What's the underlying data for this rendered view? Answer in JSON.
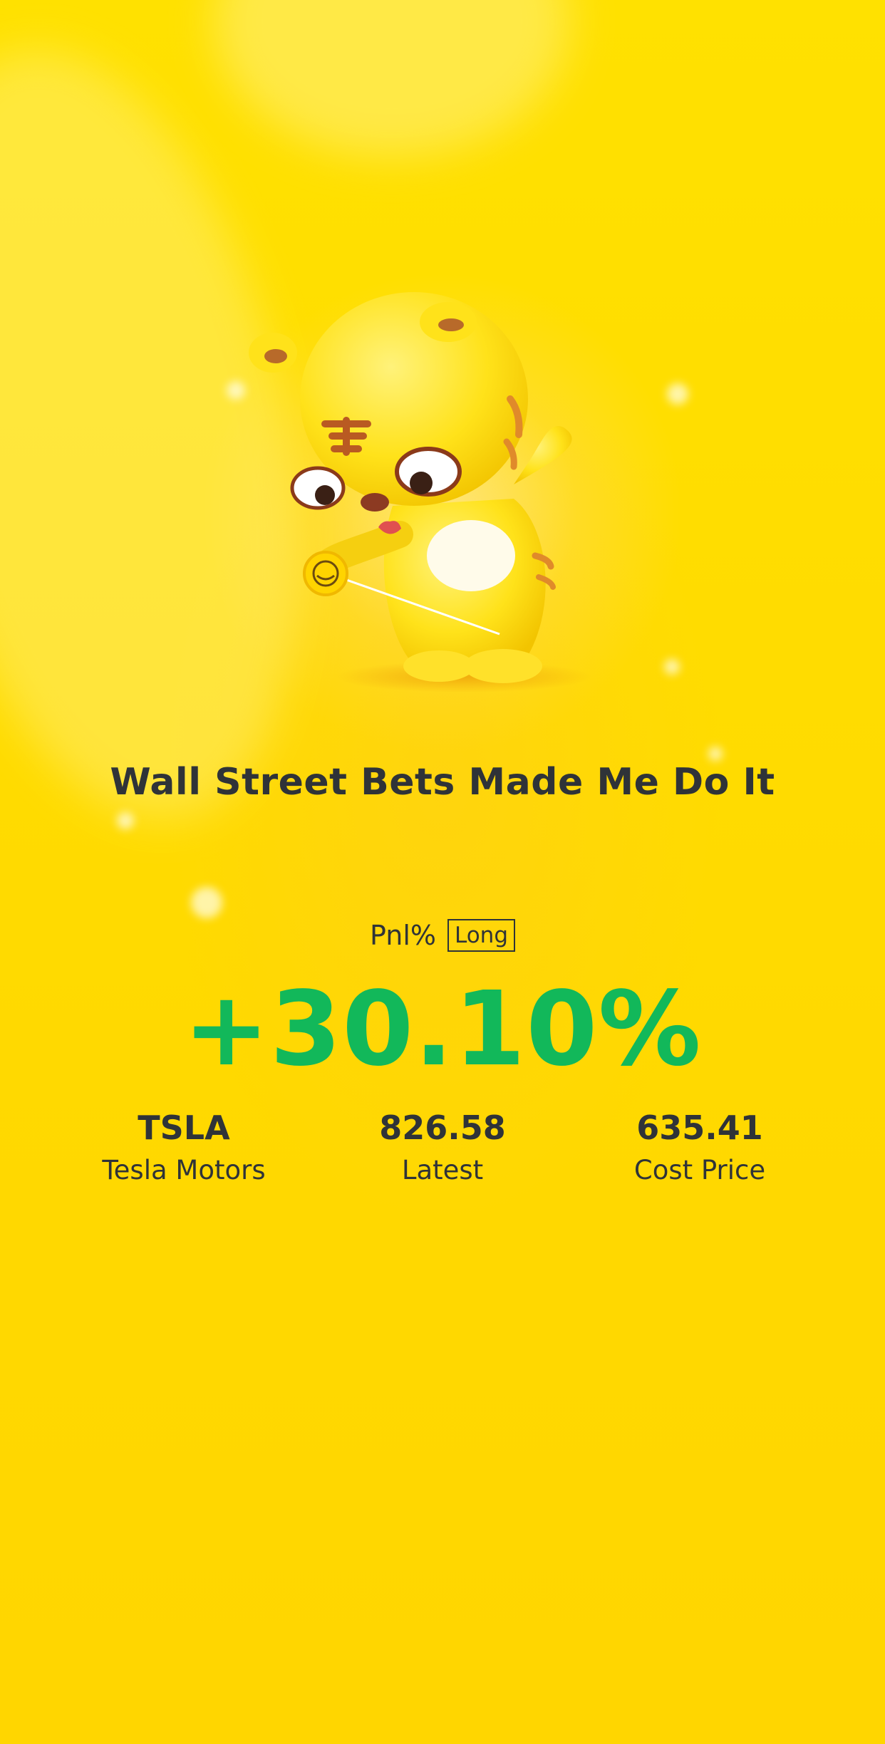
{
  "card": {
    "title": "Wall Street Bets Made Me Do It",
    "pnl_label": "Pnl%",
    "position_tag": "Long",
    "pnl_value": "+30.10%",
    "pnl_color": "#12b85a",
    "background_color": "#ffdd00"
  },
  "stats": [
    {
      "value": "TSLA",
      "label": "Tesla Motors"
    },
    {
      "value": "826.58",
      "label": "Latest"
    },
    {
      "value": "635.41",
      "label": "Cost Price"
    }
  ],
  "mascot": {
    "icon": "tiger-mascot-with-yoyo-icon"
  }
}
